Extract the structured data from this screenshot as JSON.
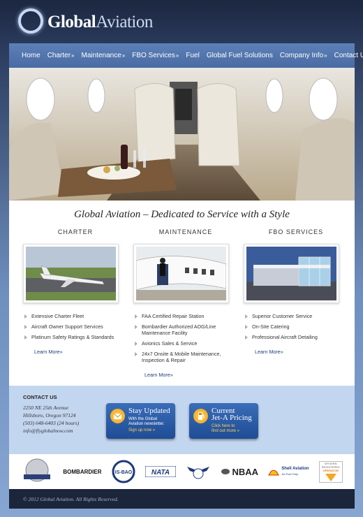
{
  "brand": {
    "name_part1": "Global",
    "name_part2": "Aviation"
  },
  "nav": [
    {
      "label": "Home",
      "submenu": false
    },
    {
      "label": "Charter",
      "submenu": true
    },
    {
      "label": "Maintenance",
      "submenu": true
    },
    {
      "label": "FBO Services",
      "submenu": true
    },
    {
      "label": "Fuel",
      "submenu": false
    },
    {
      "label": "Global Fuel Solutions",
      "submenu": false
    },
    {
      "label": "Company Info",
      "submenu": true
    },
    {
      "label": "Contact Us",
      "submenu": false
    }
  ],
  "tagline": "Global Aviation – Dedicated to Service with a Style",
  "columns": [
    {
      "title": "CHARTER",
      "bullets": [
        "Extensive Charter Fleet",
        "Aircraft Owner Support Services",
        "Platinum Safety Ratings & Standards"
      ],
      "learn": "Learn More»"
    },
    {
      "title": "MAINTENANCE",
      "bullets": [
        "FAA Certified Repair Station",
        "Bombardier Authorized AOG/Line Maintenance Facility",
        "Avionics Sales & Service",
        "24x7 Onsite & Mobile Maintenance, Inspection & Repair"
      ],
      "learn": "Learn More»"
    },
    {
      "title": "FBO SERVICES",
      "bullets": [
        "Superior Customer Service",
        "On-Site Catering",
        "Professional Aircraft Detailing"
      ],
      "learn": "Learn More»"
    }
  ],
  "contact": {
    "title": "CONTACT US",
    "address1": "2250 NE 25th Avenue",
    "address2": "Hillsboro, Oregon 97124",
    "phone": "(503) 648-6403 (24 hours)",
    "email": "info@flyglobalnow.com"
  },
  "cta": [
    {
      "title": "Stay Updated",
      "sub1": "With the Global",
      "sub2": "Aviation newsletter.",
      "link": "Sign up now »"
    },
    {
      "title1": "Current",
      "title2": "Jet-A Pricing",
      "link1": "Click here to",
      "link2": "find out more »"
    }
  ],
  "partners": [
    "BOMBARDIER",
    "IS-BAO",
    "NATA",
    "NBAA",
    "Shell Aviation",
    "Jet Fuel Only",
    "WYVERN",
    "REGISTERED",
    "OPERATOR"
  ],
  "footer": "© 2012 Global Aviation. All Rights Reserved.",
  "colors": {
    "nav": "#4f72aa",
    "accent": "#1a3f80",
    "band": "#c3d6ef",
    "footer": "#1b253b"
  }
}
